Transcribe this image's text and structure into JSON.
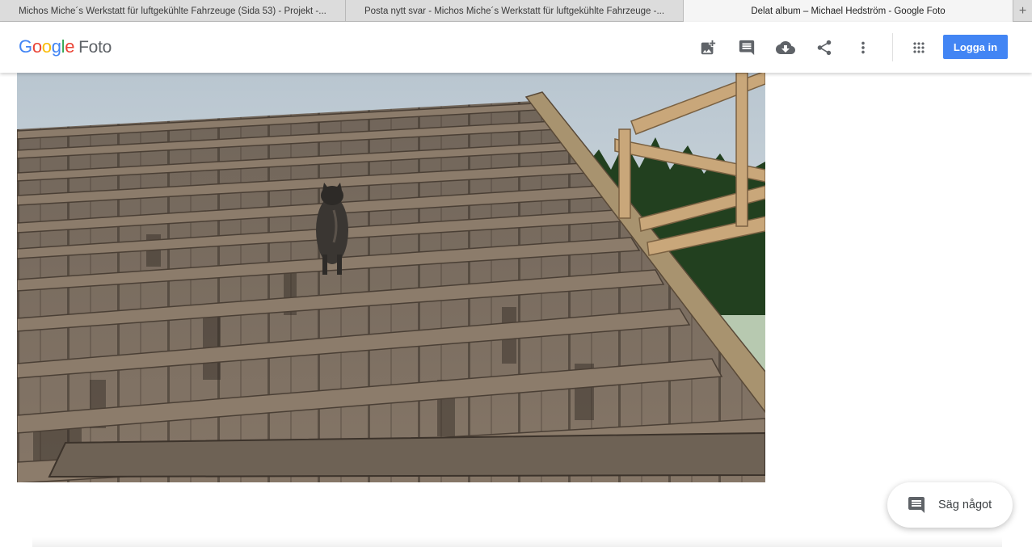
{
  "browser": {
    "tabs": [
      {
        "title": "Michos Miche´s Werkstatt für luftgekühlte Fahrzeuge (Sida 53) - Projekt -...",
        "active": false
      },
      {
        "title": "Posta nytt svar - Michos Miche´s Werkstatt für luftgekühlte Fahrzeuge -...",
        "active": false
      },
      {
        "title": "Delat album – Michael Hedström - Google Foto",
        "active": true
      }
    ],
    "new_tab_symbol": "+"
  },
  "header": {
    "logo_letters": [
      "G",
      "o",
      "o",
      "g",
      "l",
      "e"
    ],
    "logo_colors": [
      "#4285f4",
      "#ea4335",
      "#fbbc05",
      "#4285f4",
      "#34a853",
      "#ea4335"
    ],
    "logo_product": "Foto",
    "icons": [
      "add-photo-icon",
      "comment-icon",
      "download-icon",
      "share-icon",
      "more-vert-icon",
      "apps-grid-icon"
    ],
    "login_label": "Logga in",
    "accent": "#4285f4"
  },
  "photo": {
    "subject": "cat on wooden roof battens"
  },
  "comment": {
    "label": "Säg något",
    "icon": "comment-icon"
  }
}
